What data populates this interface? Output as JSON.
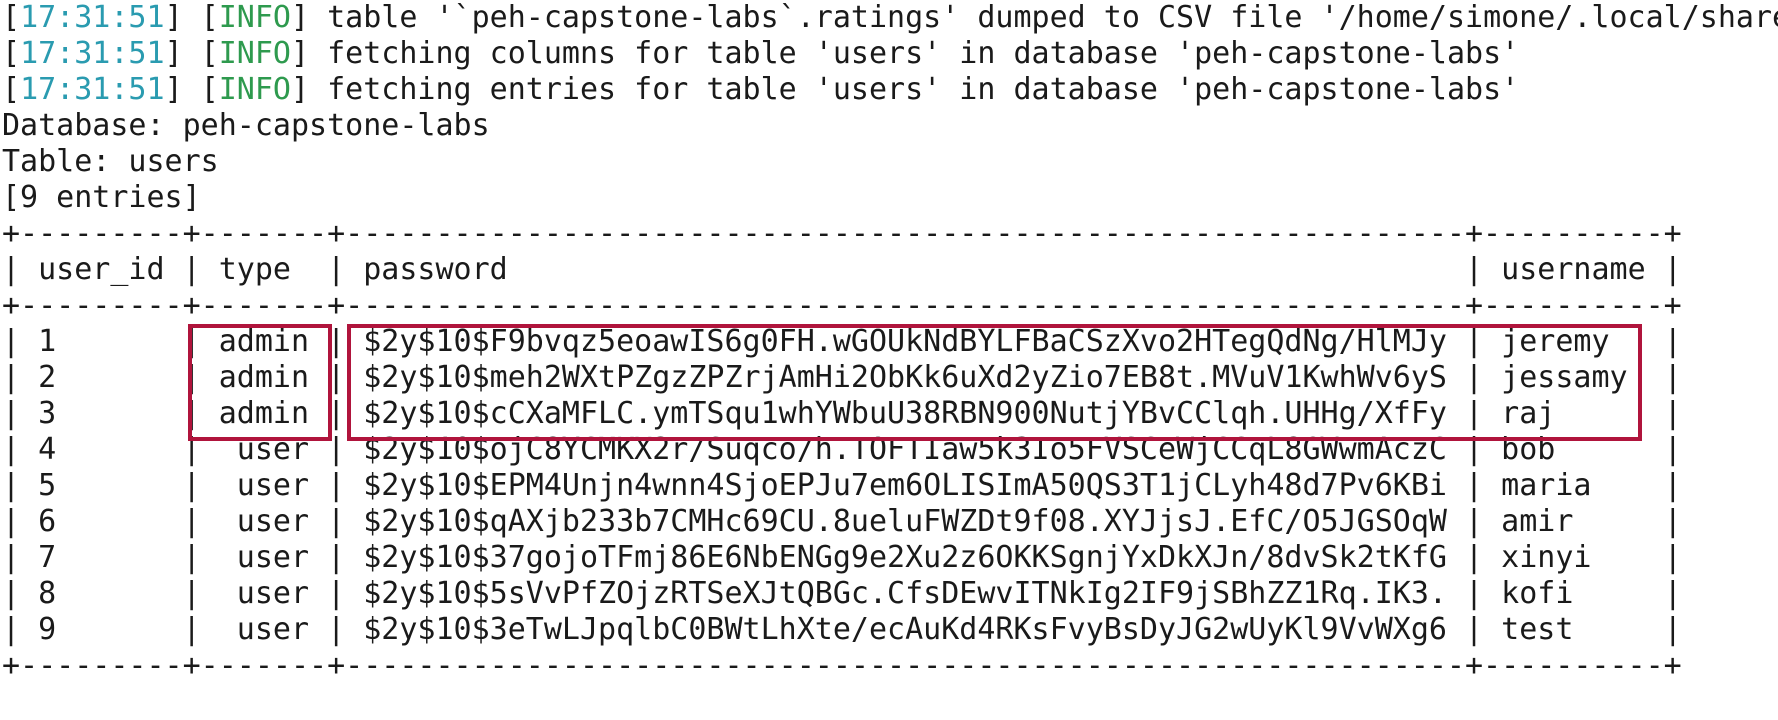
{
  "terminal": {
    "logs": [
      {
        "time": "17:31:51",
        "level": "INFO",
        "message": "table '`peh-capstone-labs`.ratings' dumped to CSV file '/home/simone/.local/share"
      },
      {
        "time": "17:31:51",
        "level": "INFO",
        "message": "fetching columns for table 'users' in database 'peh-capstone-labs'"
      },
      {
        "time": "17:31:51",
        "level": "INFO",
        "message": "fetching entries for table 'users' in database 'peh-capstone-labs'"
      }
    ],
    "database_line": "Database: peh-capstone-labs",
    "table_line": "Table: users",
    "entries_line": "[9 entries]",
    "colors": {
      "timestamp": "#2a9bb0",
      "info": "#2e9a4e",
      "highlight": "#b0143c"
    }
  },
  "table": {
    "headers": [
      "user_id",
      "type",
      "password",
      "username"
    ],
    "rows": [
      [
        "1",
        "admin",
        "$2y$10$F9bvqz5eoawIS6g0FH.wGOUkNdBYLFBaCSzXvo2HTegQdNg/HlMJy",
        "jeremy"
      ],
      [
        "2",
        "admin",
        "$2y$10$meh2WXtPZgzZPZrjAmHi2ObKk6uXd2yZio7EB8t.MVuV1KwhWv6yS",
        "jessamy"
      ],
      [
        "3",
        "admin",
        "$2y$10$cCXaMFLC.ymTSqu1whYWbuU38RBN900NutjYBvCClqh.UHHg/XfFy",
        "raj"
      ],
      [
        "4",
        "user",
        "$2y$10$ojC8YCMKX2r/Suqco/h.TOFTIaw5k3Io5FVSCeWjCCqL8GWwmAczC",
        "bob"
      ],
      [
        "5",
        "user",
        "$2y$10$EPM4Unjn4wnn4SjoEPJu7em6OLISImA50QS3T1jCLyh48d7Pv6KBi",
        "maria"
      ],
      [
        "6",
        "user",
        "$2y$10$qAXjb233b7CMHc69CU.8ueluFWZDt9f08.XYJjsJ.EfC/O5JGSOqW",
        "amir"
      ],
      [
        "7",
        "user",
        "$2y$10$37gojoTFmj86E6NbENGg9e2Xu2z6OKKSgnjYxDkXJn/8dvSk2tKfG",
        "xinyi"
      ],
      [
        "8",
        "user",
        "$2y$10$5sVvPfZOjzRTSeXJtQBGc.CfsDEwvITNkIg2IF9jSBhZZ1Rq.IK3.",
        "kofi"
      ],
      [
        "9",
        "user",
        "$2y$10$3eTwLJpqlbC0BWtLhXte/ecAuKd4RKsFvyBsDyJG2wUyKl9VvWXg6",
        "test"
      ]
    ]
  }
}
